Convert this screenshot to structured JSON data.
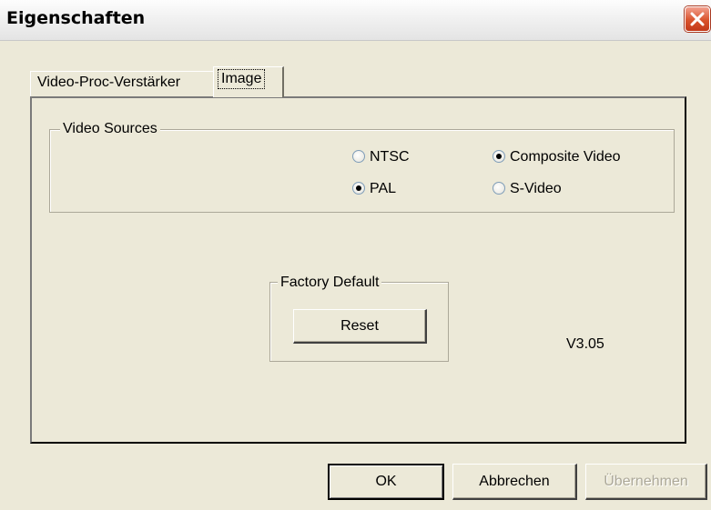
{
  "window": {
    "title": "Eigenschaften",
    "close_icon": "close-icon",
    "accent_color": "#d9532c"
  },
  "tabs": [
    {
      "label": "Video-Proc-Verstärker",
      "selected": false
    },
    {
      "label": "Image",
      "selected": true
    }
  ],
  "video_sources": {
    "label": "Video Sources",
    "standard_options": [
      {
        "label": "NTSC",
        "checked": false
      },
      {
        "label": "PAL",
        "checked": true
      }
    ],
    "input_options": [
      {
        "label": "Composite Video",
        "checked": true
      },
      {
        "label": "S-Video",
        "checked": false
      }
    ]
  },
  "factory_default": {
    "label": "Factory Default",
    "reset_label": "Reset"
  },
  "version": "V3.05",
  "footer": {
    "ok_label": "OK",
    "cancel_label": "Abbrechen",
    "apply_label": "Übernehmen",
    "apply_enabled": false
  }
}
